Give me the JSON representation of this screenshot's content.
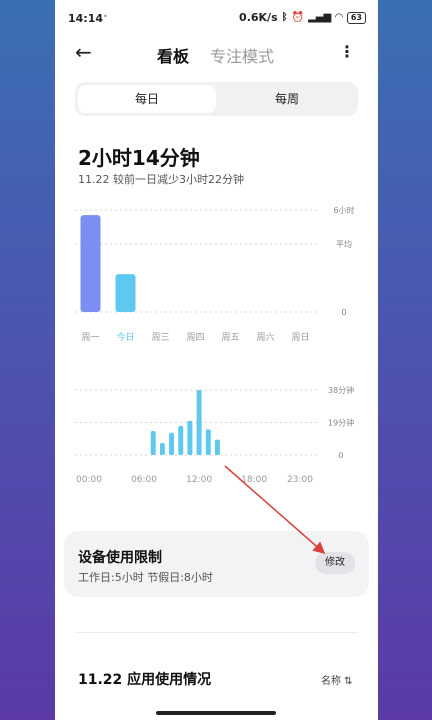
{
  "status_bar": {
    "time": "14:14",
    "dot": "•",
    "net_speed": "0.6K/s",
    "icons": [
      "bluetooth-icon",
      "alarm-icon",
      "signal-icon",
      "wifi-icon"
    ],
    "battery": "63"
  },
  "header": {
    "back_glyph": "←",
    "tab_active": "看板",
    "tab_inactive": "专注模式",
    "more_glyph": "⋮"
  },
  "segment": {
    "day": "每日",
    "week": "每周"
  },
  "summary": {
    "total": "2小时14分钟",
    "compare": "11.22  较前一日减少3小时22分钟"
  },
  "colors": {
    "accent": "#5ec8ee",
    "primary_bar": "#7c8ef2",
    "grid": "#d5d5d5",
    "arrow": "#d9403a"
  },
  "chart_data": [
    {
      "type": "bar",
      "categories": [
        "周一",
        "今日",
        "周三",
        "周四",
        "周五",
        "周六",
        "周日"
      ],
      "values": [
        5.7,
        2.23,
        0,
        0,
        0,
        0,
        0
      ],
      "ylim": [
        0,
        6
      ],
      "ytick_labels": [
        "6小时",
        "平均",
        "0"
      ],
      "average": 4.0,
      "highlight_index": 1
    },
    {
      "type": "bar",
      "x": [
        "07:00",
        "08:00",
        "09:00",
        "10:00",
        "11:00",
        "12:00",
        "13:00",
        "14:00"
      ],
      "values": [
        14,
        7,
        13,
        17,
        20,
        38,
        15,
        9
      ],
      "ylim": [
        0,
        38
      ],
      "ytick_labels": [
        "38分钟",
        "19分钟",
        "0"
      ],
      "xtick_labels": [
        "00:00",
        "06:00",
        "12:00",
        "18:00",
        "23:00"
      ]
    }
  ],
  "limit": {
    "title": "设备使用限制",
    "subtitle": "工作日:5小时  节假日:8小时",
    "edit": "修改"
  },
  "usage": {
    "title": "11.22 应用使用情况",
    "sort": "名称 ⇅"
  }
}
